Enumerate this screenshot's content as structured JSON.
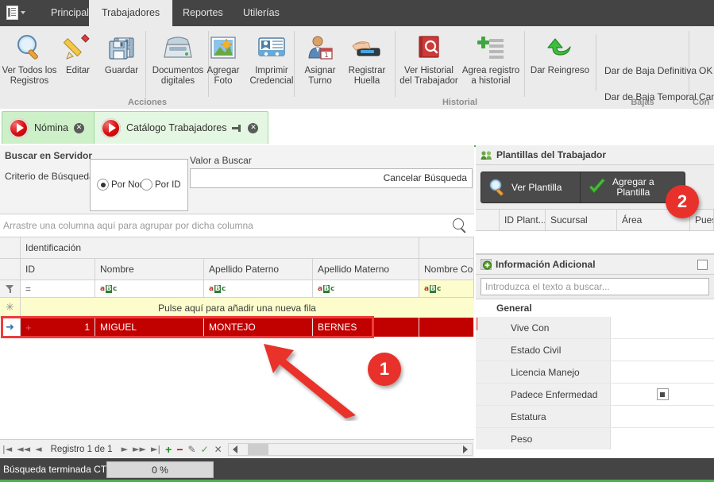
{
  "window": {
    "app_menu_icon": "menu-list-icon"
  },
  "ribbon": {
    "tabs": [
      {
        "label": "Principal",
        "active": false
      },
      {
        "label": "Trabajadores",
        "active": true
      },
      {
        "label": "Reportes",
        "active": false
      },
      {
        "label": "Utilerías",
        "active": false
      }
    ],
    "groups": [
      {
        "title": "Acciones"
      },
      {
        "title": "Historial"
      },
      {
        "title": "Bajas"
      },
      {
        "title": "Con"
      }
    ],
    "buttons": {
      "ver_todos": "Ver Todos los\nRegistros",
      "editar": "Editar",
      "guardar": "Guardar",
      "documentos": "Documentos\ndigitales",
      "agregar_foto": "Agregar\nFoto",
      "imprimir_credencial": "Imprimir\nCredencial",
      "asignar_turno": "Asignar\nTurno",
      "registrar_huella": "Registrar\nHuella",
      "ver_historial": "Ver Historial\ndel Trabajador",
      "agrega_registro": "Agrea registro\na historial",
      "dar_reingreso": "Dar Reingreso",
      "baja_definitiva": "Dar de Baja Definitiva",
      "baja_temporal": "Dar de Baja Temporal",
      "ok": "OK",
      "cancelar": "Can"
    }
  },
  "doctabs": [
    {
      "label": "Nómina",
      "selected": true,
      "pinnable": false
    },
    {
      "label": "Catálogo Trabajadores",
      "selected": false,
      "pinnable": true
    }
  ],
  "search": {
    "title": "Buscar en Servidor",
    "criterio_label": "Criterio de Búsqueda",
    "options": [
      {
        "label": "Por Nom",
        "selected": true
      },
      {
        "label": "Por ID",
        "selected": false
      }
    ],
    "valor_label": "Valor a Buscar",
    "valor_value": "",
    "cancel_label": "Cancelar Búsqueda"
  },
  "grid": {
    "group_hint": "Arrastre una columna aquí para agrupar por dicha columna",
    "band": "Identificación",
    "columns": [
      "ID",
      "Nombre",
      "Apellido Paterno",
      "Apellido Materno",
      "Nombre Comp"
    ],
    "filter_row": [
      "=",
      "aBc",
      "aBc",
      "aBc",
      "aBc"
    ],
    "new_row_text": "Pulse aquí para añadir una nueva fila",
    "rows": [
      {
        "id": "1",
        "nombre": "MIGUEL",
        "apellido_paterno": "MONTEJO",
        "apellido_materno": "BERNES",
        "nombre_completo": ""
      }
    ],
    "nav": {
      "first": "|◄",
      "prev_page": "◄◄",
      "prev": "◄",
      "record_label": "Registro 1 de 1",
      "next": "►",
      "next_page": "►►",
      "last": "►|",
      "add": "+",
      "remove": "−",
      "edit": "✎",
      "accept": "✓",
      "cancel": "✕"
    }
  },
  "templates_panel": {
    "title": "Plantillas del Trabajador",
    "icon": "people-icon",
    "ver_plantilla": "Ver Plantilla",
    "agregar_plantilla": "Agregar a\nPlantilla",
    "columns": [
      "ID Plant...",
      "Sucursal",
      "Área",
      "Pues"
    ]
  },
  "info_panel": {
    "title": "Información Adicional",
    "icon": "add-circle-icon",
    "search_placeholder": "Introduzca el texto a buscar...",
    "category": "General",
    "rows": [
      {
        "name": "Vive Con",
        "value": "",
        "type": "text"
      },
      {
        "name": "Estado Civil",
        "value": "",
        "type": "text"
      },
      {
        "name": "Licencia Manejo",
        "value": "",
        "type": "text"
      },
      {
        "name": "Padece Enfermedad",
        "value": "",
        "type": "checkbox"
      },
      {
        "name": "Estatura",
        "value": "",
        "type": "text"
      },
      {
        "name": "Peso",
        "value": "",
        "type": "text"
      }
    ]
  },
  "statusbar": {
    "message": "Búsqueda terminada CT",
    "progress_text": "0 %",
    "progress_value": 0
  },
  "annotations": [
    {
      "id": "1",
      "label": "1"
    },
    {
      "id": "2",
      "label": "2"
    }
  ],
  "colors": {
    "ribbon_dark": "#444444",
    "ribbon_body": "#ebebeb",
    "accent_green": "#4caf50",
    "tab_green": "#cdf0c8",
    "row_red": "#c10000",
    "annotation_red": "#e8312a",
    "filter_yellow": "#fcfccd"
  }
}
